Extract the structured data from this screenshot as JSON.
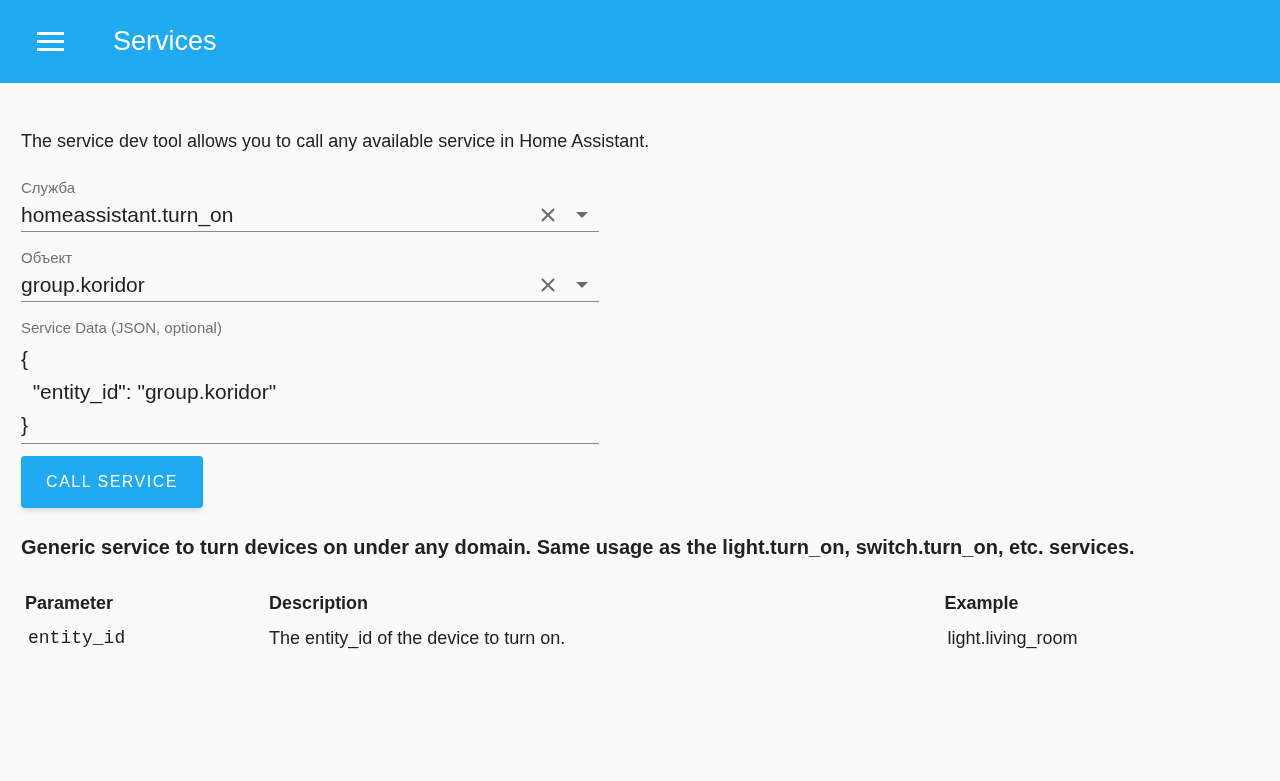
{
  "header": {
    "title": "Services"
  },
  "intro": "The service dev tool allows you to call any available service in Home Assistant.",
  "fields": [
    {
      "kind": "combo",
      "label": "Служба",
      "value": "homeassistant.turn_on"
    },
    {
      "kind": "combo",
      "label": "Объект",
      "value": "group.koridor"
    },
    {
      "kind": "textarea",
      "label": "Service Data (JSON, optional)",
      "lines": [
        "{",
        "  \"entity_id\": \"group.koridor\"",
        "}"
      ]
    }
  ],
  "button": "CALL SERVICE",
  "description": "Generic service to turn devices on under any domain. Same usage as the light.turn_on, switch.turn_on, etc. services.",
  "table": {
    "columns": [
      "Parameter",
      "Description",
      "Example"
    ],
    "rows": [
      {
        "parameter": "entity_id",
        "description": "The entity_id of the device to turn on.",
        "example": "light.living_room"
      }
    ]
  }
}
